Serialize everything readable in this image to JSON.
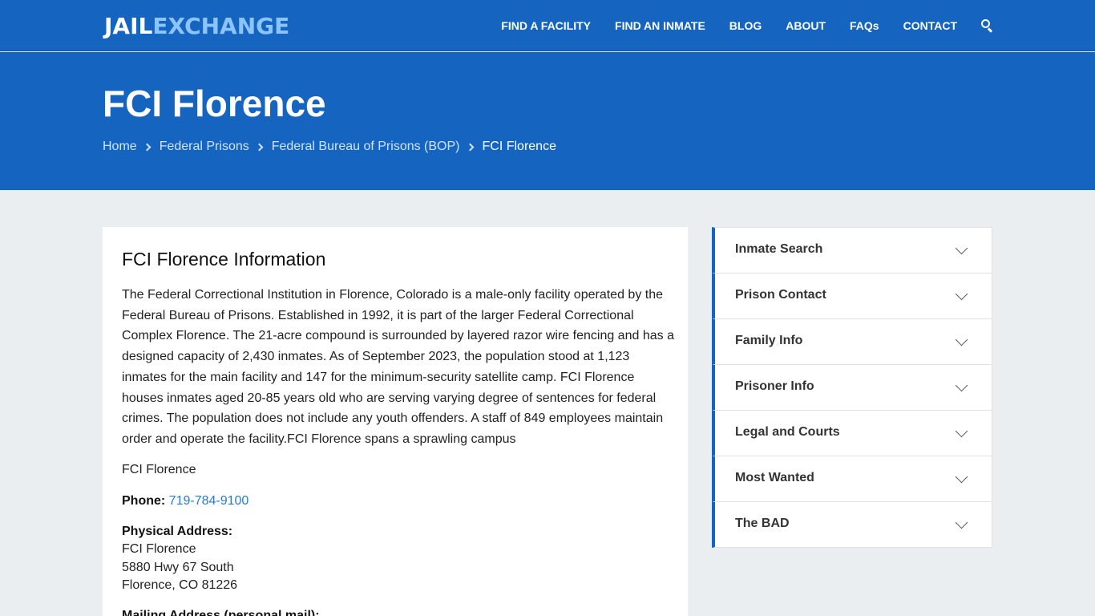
{
  "header": {
    "logo_part1": "JAIL",
    "logo_part2": "EXCHANGE",
    "nav": [
      "FIND A FACILITY",
      "FIND AN INMATE",
      "BLOG",
      "ABOUT",
      "FAQs",
      "CONTACT"
    ],
    "search_icon": "search-icon"
  },
  "hero": {
    "title": "FCI Florence",
    "breadcrumb": [
      "Home",
      "Federal Prisons",
      "Federal Bureau of Prisons (BOP)",
      "FCI Florence"
    ]
  },
  "main": {
    "heading": "FCI Florence Information",
    "intro_lines": [
      "The Federal Correctional Institution in Florence, Colorado is a male-only facility operated by the",
      "Federal Bureau of Prisons. Established in 1992, it is part of the larger Federal Correctional",
      "Complex Florence. The 21-acre compound is surrounded by layered razor wire fencing and has a",
      "designed capacity of 2,430 inmates. As of September 2023, the population stood at 1,123",
      "inmates for the main facility and 147 for the minimum-security satellite camp. FCI Florence",
      "houses inmates aged 20-85 years old who are serving varying degree of sentences for federal",
      "crimes. The population does not include any youth offenders. A staff of 849 employees maintain",
      "order and operate the facility.FCI Florence spans a sprawling campus"
    ],
    "facility_name": "FCI Florence",
    "phone_label": "Phone:",
    "phone": "719-784-9100",
    "address_label": "Physical Address:",
    "address_lines": [
      "FCI Florence",
      "5880 Hwy 67 South",
      "Florence, CO 81226"
    ],
    "mailing_label": "Mailing Address (personal mail):"
  },
  "sidebar": {
    "items": [
      "Inmate Search",
      "Prison Contact",
      "Family Info",
      "Prisoner Info",
      "Legal and Courts",
      "Most Wanted",
      "The BAD"
    ]
  },
  "colors": {
    "brand_blue": "#1565c0",
    "logo_accent": "#8cc4ff",
    "link": "#2a7bd0",
    "page_bg": "#ebeef1"
  }
}
